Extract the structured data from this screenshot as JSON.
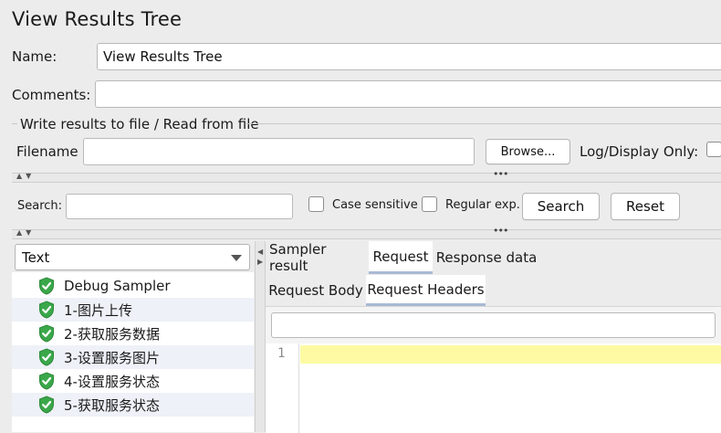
{
  "window_title": "View Results Tree",
  "name_field": {
    "label": "Name:",
    "value": "View Results Tree"
  },
  "comments_field": {
    "label": "Comments:",
    "value": ""
  },
  "file_section": {
    "legend": "Write results to file / Read from file",
    "filename_label": "Filename",
    "filename_value": "",
    "browse_label": "Browse...",
    "log_display_label": "Log/Display Only:"
  },
  "search_bar": {
    "label": "Search:",
    "value": "",
    "case_sensitive_label": "Case sensitive",
    "regular_exp_label": "Regular exp.",
    "search_button": "Search",
    "reset_button": "Reset"
  },
  "renderer_select": {
    "selected": "Text"
  },
  "tree": {
    "items": [
      {
        "label": "Debug Sampler",
        "status": "success"
      },
      {
        "label": "1-图片上传",
        "status": "success"
      },
      {
        "label": "2-获取服务数据",
        "status": "success"
      },
      {
        "label": "3-设置服务图片",
        "status": "success"
      },
      {
        "label": "4-设置服务状态",
        "status": "success"
      },
      {
        "label": "5-获取服务状态",
        "status": "success"
      }
    ]
  },
  "result_tabs": [
    {
      "label": "Sampler result",
      "selected": false
    },
    {
      "label": "Request",
      "selected": true
    },
    {
      "label": "Response data",
      "selected": false
    }
  ],
  "request_tabs": [
    {
      "label": "Request Body",
      "selected": false
    },
    {
      "label": "Request Headers",
      "selected": true
    }
  ],
  "editor": {
    "line_number": "1",
    "content": ""
  },
  "colors": {
    "success_shield": "#3aa84a",
    "highlight_line": "#fdfaa3",
    "selected_tab_underline": "#a9b9d4",
    "alt_row": "#eef1f7"
  }
}
